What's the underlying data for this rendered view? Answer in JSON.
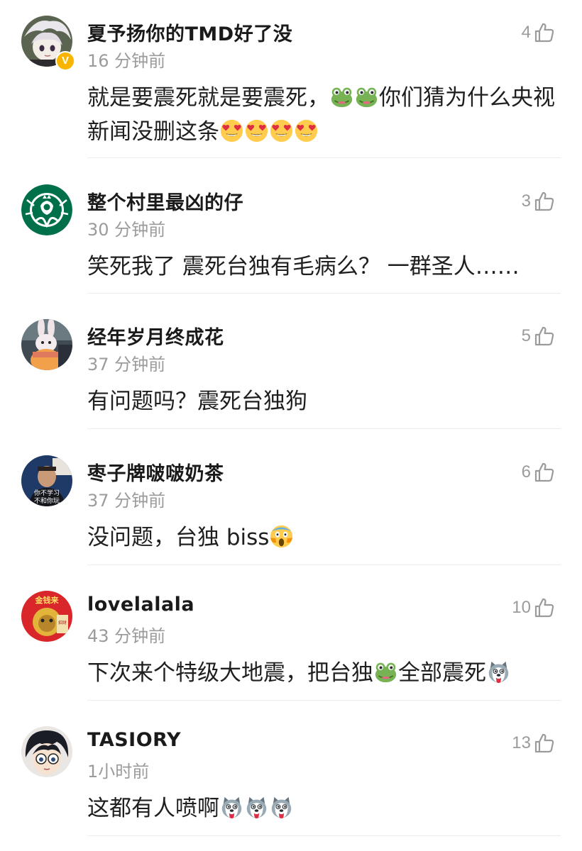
{
  "comments": [
    {
      "username": "夏予扬你的TMD好了没",
      "time": "16 分钟前",
      "likes": "4",
      "verified": true,
      "avatar_icon": "anime-character-avatar",
      "text_parts": [
        "就是要震死就是要震死，",
        "{frog}",
        "{frog}",
        "你们猜为什么央视新闻没删这条",
        "{heart-eyes}",
        "{heart-eyes}",
        "{heart-eyes}",
        "{heart-eyes}"
      ]
    },
    {
      "username": "整个村里最凶的仔",
      "time": "30 分钟前",
      "likes": "3",
      "verified": false,
      "avatar_icon": "green-siren-logo-avatar",
      "text_parts": [
        "笑死我了 震死台独有毛病么？ 一群圣人……"
      ]
    },
    {
      "username": "经年岁月终成花",
      "time": "37 分钟前",
      "likes": "5",
      "verified": false,
      "avatar_icon": "plush-bunny-photo-avatar",
      "text_parts": [
        "有问题吗？震死台独狗"
      ]
    },
    {
      "username": "枣子牌啵啵奶茶",
      "time": "37 分钟前",
      "likes": "6",
      "verified": false,
      "avatar_icon": "meme-photo-avatar",
      "avatar_text": [
        "你不学习",
        "不和你玩"
      ],
      "text_parts": [
        "没问题，台独 biss",
        "{scream}"
      ]
    },
    {
      "username": "lovelalala",
      "time": "43 分钟前",
      "likes": "10",
      "verified": false,
      "avatar_icon": "lion-dance-avatar",
      "avatar_text": [
        "金钱来",
        "招财"
      ],
      "text_parts": [
        "下次来个特级大地震，把台独",
        "{frog}",
        "全部震死",
        "{husky}"
      ]
    },
    {
      "username": "TASIORY",
      "time": "1小时前",
      "likes": "13",
      "verified": false,
      "avatar_icon": "anime-boy-glasses-avatar",
      "text_parts": [
        "这都有人喷啊",
        "{husky}",
        "{husky}",
        "{husky}"
      ]
    }
  ],
  "colors": {
    "username": "#1a1a1a",
    "meta": "#9b9b9b",
    "body": "#1f1f1f",
    "divider": "#ececec",
    "verified": "#f7b500"
  }
}
